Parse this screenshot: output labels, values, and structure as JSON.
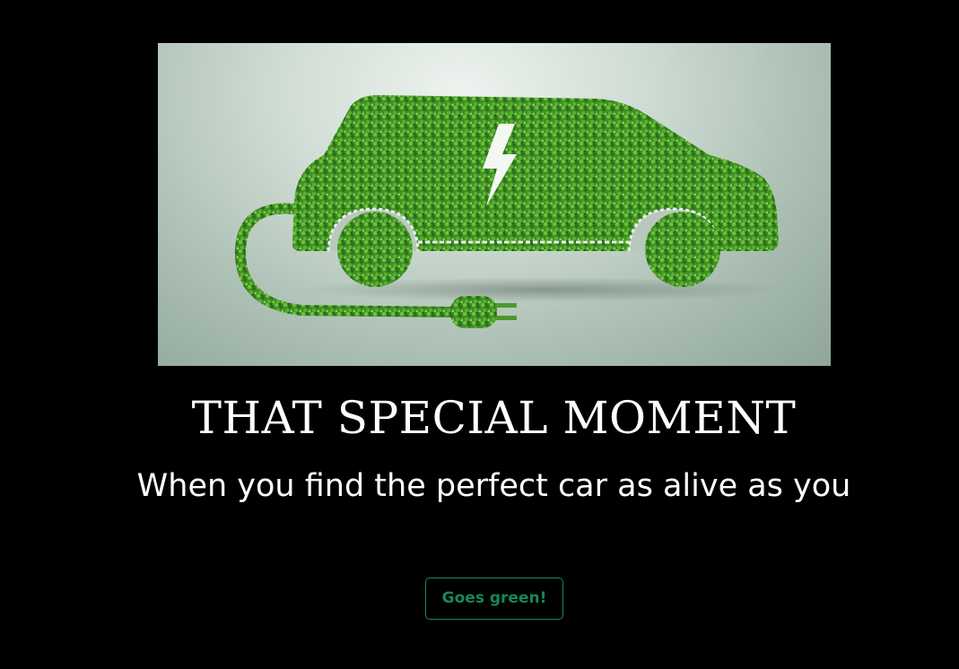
{
  "hero": {
    "image_alt": "Green electric car made of leaves with plug",
    "icon": "lightning-bolt"
  },
  "heading": {
    "title": "THAT SPECIAL MOMENT",
    "subtitle": "When you find the perfect car as alive as you"
  },
  "cta": {
    "label": "Goes green!",
    "color": "#198754"
  },
  "colors": {
    "background": "#000000",
    "text": "#ffffff",
    "leaf_green": "#4a9a2e"
  }
}
